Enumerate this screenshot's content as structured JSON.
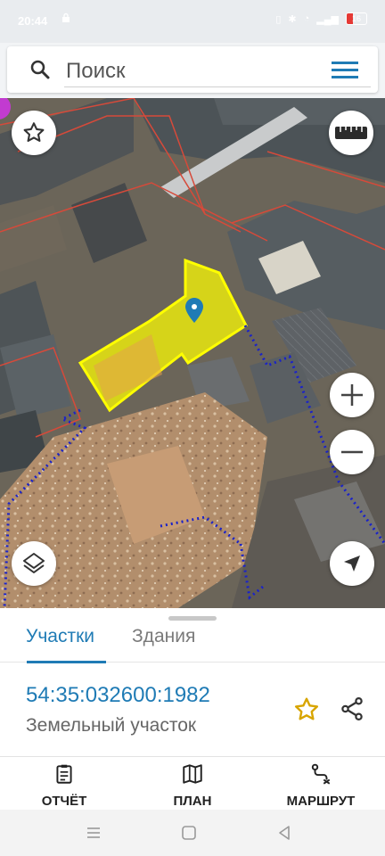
{
  "status_bar": {
    "time": "20:44",
    "battery": "16"
  },
  "search": {
    "placeholder": "Поиск"
  },
  "tabs": [
    {
      "label": "Участки",
      "active": true
    },
    {
      "label": "Здания",
      "active": false
    }
  ],
  "parcel": {
    "number": "54:35:032600:1982",
    "type": "Земельный участок"
  },
  "bottom_nav": [
    {
      "label": "ОТЧЁТ",
      "icon": "report-icon"
    },
    {
      "label": "ПЛАН",
      "icon": "map-plan-icon"
    },
    {
      "label": "МАРШРУТ",
      "icon": "route-icon"
    }
  ],
  "map_controls": [
    "favorite-star-icon",
    "ruler-icon",
    "zoom-in-icon",
    "zoom-out-icon",
    "layers-icon",
    "locate-icon"
  ],
  "colors": {
    "accent": "#1f7bb5",
    "parcel_fill": "#ffff00",
    "boundary": "#1a22c9"
  }
}
